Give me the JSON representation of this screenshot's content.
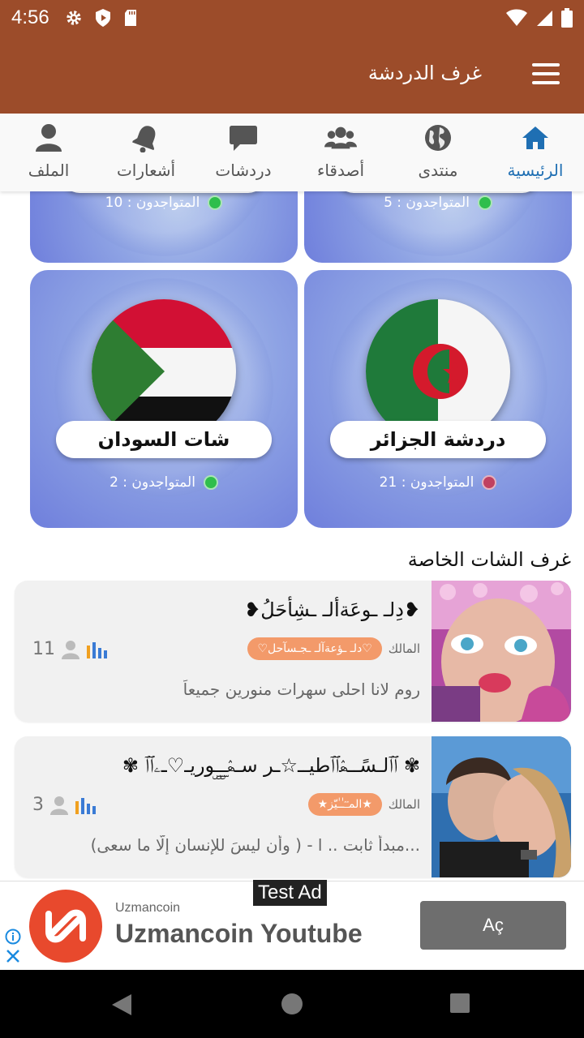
{
  "status": {
    "time": "4:56"
  },
  "app_bar": {
    "title": "غرف الدردشة"
  },
  "tabs": [
    {
      "label": "الرئيسية",
      "icon": "home-icon",
      "active": true
    },
    {
      "label": "منتدى",
      "icon": "globe-icon",
      "active": false
    },
    {
      "label": "أصدقاء",
      "icon": "friends-icon",
      "active": false
    },
    {
      "label": "دردشات",
      "icon": "chat-icon",
      "active": false
    },
    {
      "label": "أشعارات",
      "icon": "bell-icon",
      "active": false
    },
    {
      "label": "الملف",
      "icon": "profile-icon",
      "active": false
    }
  ],
  "rooms_partial": [
    {
      "online_label": "المتواجدون : 5"
    },
    {
      "online_label": "المتواجدون : 10"
    }
  ],
  "rooms": [
    {
      "name": "دردشة الجزائر",
      "online_label": "المتواجدون : 21",
      "flag": "algeria",
      "status_color": "#c04060"
    },
    {
      "name": "شات السودان",
      "online_label": "المتواجدون : 2",
      "flag": "sudan",
      "status_color": "#2fbe4c"
    }
  ],
  "private_section": {
    "title": "غرف الشات الخاصة"
  },
  "private_rooms": [
    {
      "title": "❥دِلـ ـوعَةألـ ـشِأحَلُ❥",
      "owner_label": "المالك",
      "owner": "♡دلـ ـؤعةآلـ ـجـسآحل♡",
      "count": "11",
      "description": "روم لانا احلى سهرات منورين جميعاً"
    },
    {
      "title": "✾ ٱٱلـسًــۿٱٱطيــ☆ـر سـۿـۣـۣـۣوريـ♡ـۦٱٱ ✾",
      "owner_label": "المالك",
      "owner": "★المـۘـۘـٰٰـٰيّز★",
      "count": "3",
      "description": "(وأن ليسَ للإنسان إلّا ما سعى ) - مبدأ ثابت .. ا..."
    }
  ],
  "ad": {
    "tag": "Test Ad",
    "advertiser": "Uzmancoin",
    "headline": "Uzmancoin Youtube",
    "cta": "Aç"
  }
}
